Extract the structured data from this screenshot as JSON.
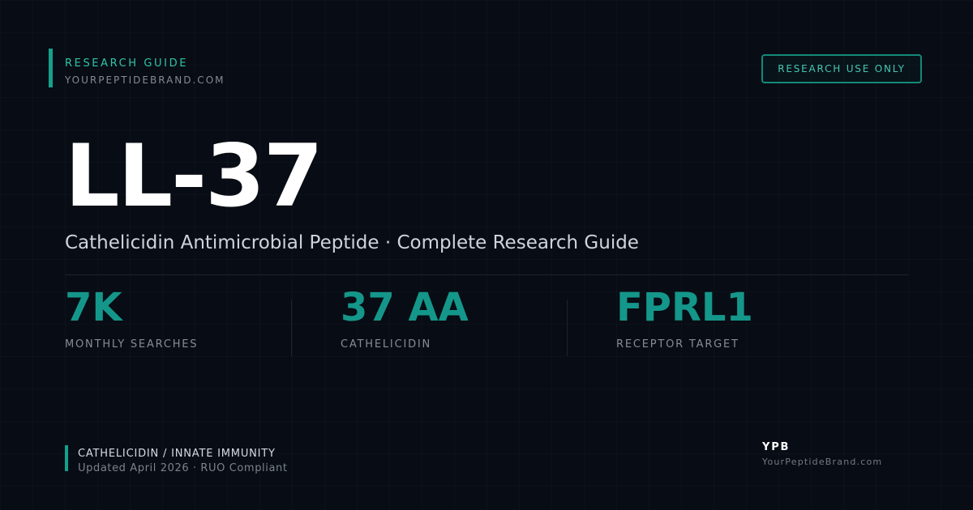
{
  "header": {
    "eyebrow": "RESEARCH GUIDE",
    "site": "YOURPEPTIDEBRAND.COM",
    "badge": "RESEARCH USE ONLY"
  },
  "hero": {
    "title": "LL-37",
    "subtitle": "Cathelicidin Antimicrobial Peptide · Complete Research Guide"
  },
  "stats": [
    {
      "value": "7K",
      "label": "MONTHLY SEARCHES"
    },
    {
      "value": "37 AA",
      "label": "CATHELICIDIN"
    },
    {
      "value": "FPRL1",
      "label": "RECEPTOR TARGET"
    }
  ],
  "footer": {
    "category": "CATHELICIDIN / INNATE IMMUNITY",
    "updated": "Updated April 2026 · RUO Compliant",
    "brand_mark": "YPB",
    "brand_site": "YourPeptideBrand.com"
  },
  "colors": {
    "background": "#080c14",
    "accent": "#14978a",
    "accent_light": "#2fc4a9",
    "text_primary": "#ffffff",
    "text_muted": "#868d98"
  }
}
